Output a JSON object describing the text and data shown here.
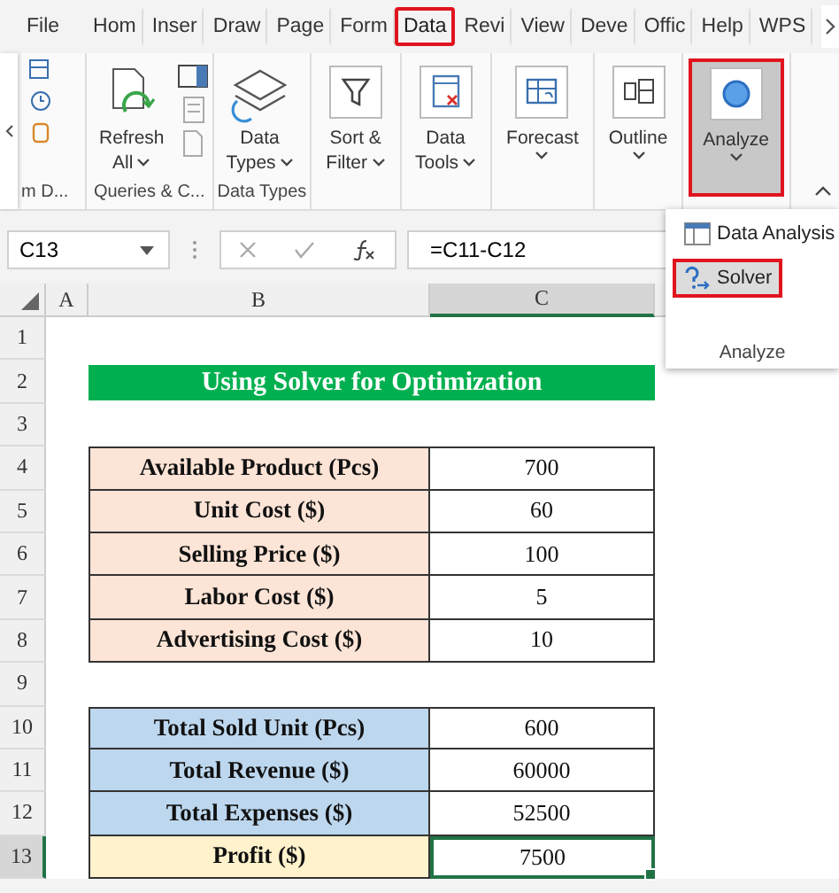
{
  "ribbon_tabs": [
    {
      "label": "File",
      "selected": false,
      "highlighted": false
    },
    {
      "label": "Hom",
      "selected": false,
      "highlighted": false
    },
    {
      "label": "Inser",
      "selected": false,
      "highlighted": false
    },
    {
      "label": "Draw",
      "selected": false,
      "highlighted": false
    },
    {
      "label": "Page",
      "selected": false,
      "highlighted": false
    },
    {
      "label": "Form",
      "selected": false,
      "highlighted": false
    },
    {
      "label": "Data",
      "selected": true,
      "highlighted": true
    },
    {
      "label": "Revi",
      "selected": false,
      "highlighted": false
    },
    {
      "label": "View",
      "selected": false,
      "highlighted": false
    },
    {
      "label": "Deve",
      "selected": false,
      "highlighted": false
    },
    {
      "label": "Offic",
      "selected": false,
      "highlighted": false
    },
    {
      "label": "Help",
      "selected": false,
      "highlighted": false
    },
    {
      "label": "WPS",
      "selected": false,
      "highlighted": false
    }
  ],
  "ribbon_groups": [
    {
      "kind": "partial",
      "label": "m D..."
    },
    {
      "kind": "queries",
      "label": "Queries & C...",
      "lines": [
        "Refresh",
        "All"
      ]
    },
    {
      "kind": "large",
      "label": "Data Types",
      "lines": [
        "Data",
        "Types"
      ],
      "highlighted": false
    },
    {
      "kind": "boxed",
      "lines": [
        "Sort &",
        "Filter"
      ],
      "highlighted": false
    },
    {
      "kind": "boxed",
      "lines": [
        "Data",
        "Tools"
      ],
      "highlighted": false
    },
    {
      "kind": "boxed",
      "lines": [
        "Forecast"
      ],
      "highlighted": false
    },
    {
      "kind": "boxed",
      "lines": [
        "Outline"
      ],
      "highlighted": false
    },
    {
      "kind": "boxed",
      "lines": [
        "Analyze"
      ],
      "highlighted": true
    }
  ],
  "analyze_menu": {
    "items": [
      {
        "label": "Data Analysis",
        "highlighted": false
      },
      {
        "label": "Solver",
        "highlighted": true
      }
    ],
    "group_label": "Analyze"
  },
  "formula_bar": {
    "name_box": "C13",
    "formula": "=C11-C12"
  },
  "sheet": {
    "columns": [
      {
        "label": "A",
        "selected": false
      },
      {
        "label": "B",
        "selected": false
      },
      {
        "label": "C",
        "selected": true
      }
    ],
    "rows": [
      {
        "header": "1",
        "kind": "blank",
        "selected": false
      },
      {
        "header": "2",
        "kind": "title",
        "text": "Using Solver for Optimization",
        "selected": false
      },
      {
        "header": "3",
        "kind": "blank",
        "selected": false
      },
      {
        "header": "4",
        "kind": "pair",
        "label": "Available Product (Pcs)",
        "value": "700",
        "color": "#fce4d6",
        "selected": false
      },
      {
        "header": "5",
        "kind": "pair",
        "label": "Unit Cost ($)",
        "value": "60",
        "color": "#fce4d6",
        "selected": false
      },
      {
        "header": "6",
        "kind": "pair",
        "label": "Selling Price ($)",
        "value": "100",
        "color": "#fce4d6",
        "selected": false
      },
      {
        "header": "7",
        "kind": "pair",
        "label": "Labor Cost ($)",
        "value": "5",
        "color": "#fce4d6",
        "selected": false
      },
      {
        "header": "8",
        "kind": "pair",
        "label": "Advertising Cost ($)",
        "value": "10",
        "color": "#fce4d6",
        "selected": false
      },
      {
        "header": "9",
        "kind": "blank",
        "selected": false
      },
      {
        "header": "10",
        "kind": "pair",
        "label": "Total Sold Unit (Pcs)",
        "value": "600",
        "color": "#bdd7ee",
        "selected": false
      },
      {
        "header": "11",
        "kind": "pair",
        "label": "Total Revenue ($)",
        "value": "60000",
        "color": "#bdd7ee",
        "selected": false
      },
      {
        "header": "12",
        "kind": "pair",
        "label": "Total Expenses ($)",
        "value": "52500",
        "color": "#bdd7ee",
        "selected": false
      },
      {
        "header": "13",
        "kind": "pair",
        "label": "Profit ($)",
        "value": "7500",
        "color": "#fff2cc",
        "selected": true
      }
    ]
  }
}
